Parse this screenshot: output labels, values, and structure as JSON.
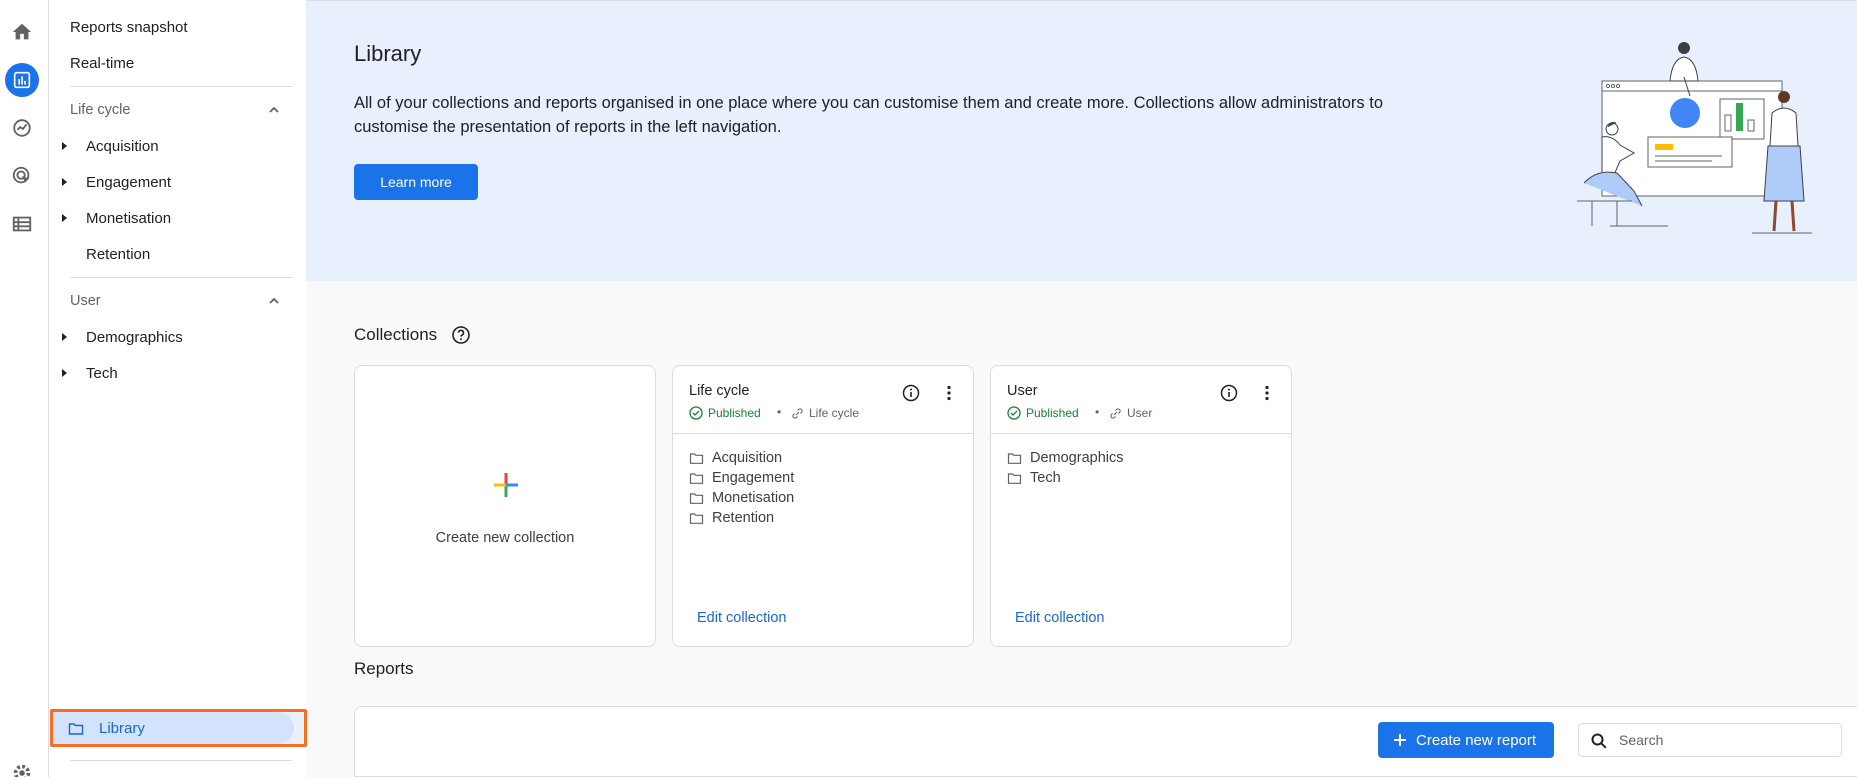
{
  "sidenav": {
    "top_items": [
      "Reports snapshot",
      "Real-time"
    ],
    "sections": [
      {
        "title": "Life cycle",
        "items": [
          "Acquisition",
          "Engagement",
          "Monetisation",
          "Retention"
        ]
      },
      {
        "title": "User",
        "items": [
          "Demographics",
          "Tech"
        ]
      }
    ],
    "library_label": "Library"
  },
  "hero": {
    "title": "Library",
    "description": "All of your collections and reports organised in one place where you can customise them and create more. Collections allow administrators to customise the presentation of reports in the left navigation.",
    "learn_more": "Learn more"
  },
  "collections": {
    "title": "Collections",
    "create_label": "Create new collection",
    "cards": [
      {
        "title": "Life cycle",
        "status": "Published",
        "template": "Life cycle",
        "folders": [
          "Acquisition",
          "Engagement",
          "Monetisation",
          "Retention"
        ],
        "edit": "Edit collection"
      },
      {
        "title": "User",
        "status": "Published",
        "template": "User",
        "folders": [
          "Demographics",
          "Tech"
        ],
        "edit": "Edit collection"
      }
    ]
  },
  "reports": {
    "title": "Reports",
    "create_label": "Create new report",
    "search_placeholder": "Search"
  },
  "colors": {
    "accent": "#1a73e8",
    "published": "#188038",
    "highlight_border": "#f4701f"
  },
  "icons": [
    "home-icon",
    "reports-icon",
    "explore-icon",
    "advertising-icon",
    "configure-icon",
    "settings-icon",
    "folder-icon",
    "help-icon",
    "info-icon",
    "more-vert-icon",
    "search-icon"
  ]
}
